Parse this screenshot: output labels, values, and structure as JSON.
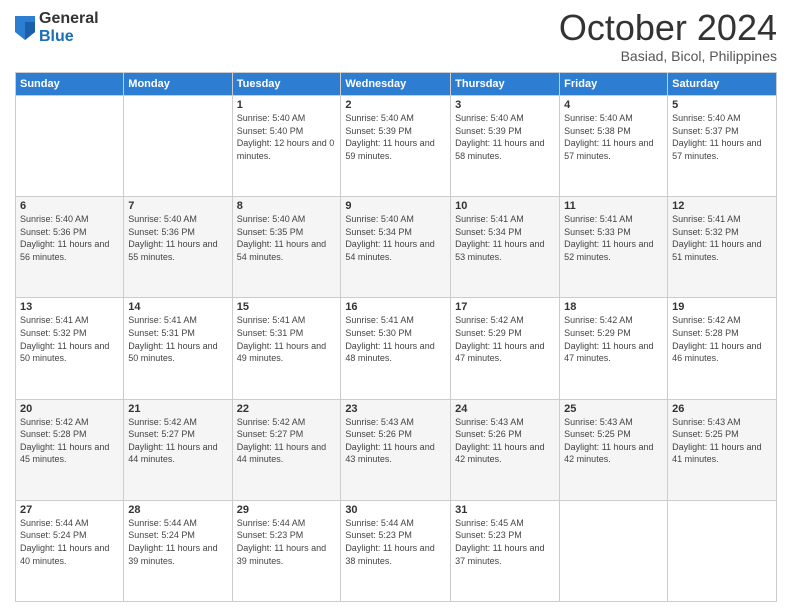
{
  "logo": {
    "general": "General",
    "blue": "Blue"
  },
  "header": {
    "month": "October 2024",
    "location": "Basiad, Bicol, Philippines"
  },
  "weekdays": [
    "Sunday",
    "Monday",
    "Tuesday",
    "Wednesday",
    "Thursday",
    "Friday",
    "Saturday"
  ],
  "weeks": [
    [
      null,
      null,
      {
        "day": "1",
        "sunrise": "Sunrise: 5:40 AM",
        "sunset": "Sunset: 5:40 PM",
        "daylight": "Daylight: 12 hours and 0 minutes."
      },
      {
        "day": "2",
        "sunrise": "Sunrise: 5:40 AM",
        "sunset": "Sunset: 5:39 PM",
        "daylight": "Daylight: 11 hours and 59 minutes."
      },
      {
        "day": "3",
        "sunrise": "Sunrise: 5:40 AM",
        "sunset": "Sunset: 5:39 PM",
        "daylight": "Daylight: 11 hours and 58 minutes."
      },
      {
        "day": "4",
        "sunrise": "Sunrise: 5:40 AM",
        "sunset": "Sunset: 5:38 PM",
        "daylight": "Daylight: 11 hours and 57 minutes."
      },
      {
        "day": "5",
        "sunrise": "Sunrise: 5:40 AM",
        "sunset": "Sunset: 5:37 PM",
        "daylight": "Daylight: 11 hours and 57 minutes."
      }
    ],
    [
      {
        "day": "6",
        "sunrise": "Sunrise: 5:40 AM",
        "sunset": "Sunset: 5:36 PM",
        "daylight": "Daylight: 11 hours and 56 minutes."
      },
      {
        "day": "7",
        "sunrise": "Sunrise: 5:40 AM",
        "sunset": "Sunset: 5:36 PM",
        "daylight": "Daylight: 11 hours and 55 minutes."
      },
      {
        "day": "8",
        "sunrise": "Sunrise: 5:40 AM",
        "sunset": "Sunset: 5:35 PM",
        "daylight": "Daylight: 11 hours and 54 minutes."
      },
      {
        "day": "9",
        "sunrise": "Sunrise: 5:40 AM",
        "sunset": "Sunset: 5:34 PM",
        "daylight": "Daylight: 11 hours and 54 minutes."
      },
      {
        "day": "10",
        "sunrise": "Sunrise: 5:41 AM",
        "sunset": "Sunset: 5:34 PM",
        "daylight": "Daylight: 11 hours and 53 minutes."
      },
      {
        "day": "11",
        "sunrise": "Sunrise: 5:41 AM",
        "sunset": "Sunset: 5:33 PM",
        "daylight": "Daylight: 11 hours and 52 minutes."
      },
      {
        "day": "12",
        "sunrise": "Sunrise: 5:41 AM",
        "sunset": "Sunset: 5:32 PM",
        "daylight": "Daylight: 11 hours and 51 minutes."
      }
    ],
    [
      {
        "day": "13",
        "sunrise": "Sunrise: 5:41 AM",
        "sunset": "Sunset: 5:32 PM",
        "daylight": "Daylight: 11 hours and 50 minutes."
      },
      {
        "day": "14",
        "sunrise": "Sunrise: 5:41 AM",
        "sunset": "Sunset: 5:31 PM",
        "daylight": "Daylight: 11 hours and 50 minutes."
      },
      {
        "day": "15",
        "sunrise": "Sunrise: 5:41 AM",
        "sunset": "Sunset: 5:31 PM",
        "daylight": "Daylight: 11 hours and 49 minutes."
      },
      {
        "day": "16",
        "sunrise": "Sunrise: 5:41 AM",
        "sunset": "Sunset: 5:30 PM",
        "daylight": "Daylight: 11 hours and 48 minutes."
      },
      {
        "day": "17",
        "sunrise": "Sunrise: 5:42 AM",
        "sunset": "Sunset: 5:29 PM",
        "daylight": "Daylight: 11 hours and 47 minutes."
      },
      {
        "day": "18",
        "sunrise": "Sunrise: 5:42 AM",
        "sunset": "Sunset: 5:29 PM",
        "daylight": "Daylight: 11 hours and 47 minutes."
      },
      {
        "day": "19",
        "sunrise": "Sunrise: 5:42 AM",
        "sunset": "Sunset: 5:28 PM",
        "daylight": "Daylight: 11 hours and 46 minutes."
      }
    ],
    [
      {
        "day": "20",
        "sunrise": "Sunrise: 5:42 AM",
        "sunset": "Sunset: 5:28 PM",
        "daylight": "Daylight: 11 hours and 45 minutes."
      },
      {
        "day": "21",
        "sunrise": "Sunrise: 5:42 AM",
        "sunset": "Sunset: 5:27 PM",
        "daylight": "Daylight: 11 hours and 44 minutes."
      },
      {
        "day": "22",
        "sunrise": "Sunrise: 5:42 AM",
        "sunset": "Sunset: 5:27 PM",
        "daylight": "Daylight: 11 hours and 44 minutes."
      },
      {
        "day": "23",
        "sunrise": "Sunrise: 5:43 AM",
        "sunset": "Sunset: 5:26 PM",
        "daylight": "Daylight: 11 hours and 43 minutes."
      },
      {
        "day": "24",
        "sunrise": "Sunrise: 5:43 AM",
        "sunset": "Sunset: 5:26 PM",
        "daylight": "Daylight: 11 hours and 42 minutes."
      },
      {
        "day": "25",
        "sunrise": "Sunrise: 5:43 AM",
        "sunset": "Sunset: 5:25 PM",
        "daylight": "Daylight: 11 hours and 42 minutes."
      },
      {
        "day": "26",
        "sunrise": "Sunrise: 5:43 AM",
        "sunset": "Sunset: 5:25 PM",
        "daylight": "Daylight: 11 hours and 41 minutes."
      }
    ],
    [
      {
        "day": "27",
        "sunrise": "Sunrise: 5:44 AM",
        "sunset": "Sunset: 5:24 PM",
        "daylight": "Daylight: 11 hours and 40 minutes."
      },
      {
        "day": "28",
        "sunrise": "Sunrise: 5:44 AM",
        "sunset": "Sunset: 5:24 PM",
        "daylight": "Daylight: 11 hours and 39 minutes."
      },
      {
        "day": "29",
        "sunrise": "Sunrise: 5:44 AM",
        "sunset": "Sunset: 5:23 PM",
        "daylight": "Daylight: 11 hours and 39 minutes."
      },
      {
        "day": "30",
        "sunrise": "Sunrise: 5:44 AM",
        "sunset": "Sunset: 5:23 PM",
        "daylight": "Daylight: 11 hours and 38 minutes."
      },
      {
        "day": "31",
        "sunrise": "Sunrise: 5:45 AM",
        "sunset": "Sunset: 5:23 PM",
        "daylight": "Daylight: 11 hours and 37 minutes."
      },
      null,
      null
    ]
  ]
}
